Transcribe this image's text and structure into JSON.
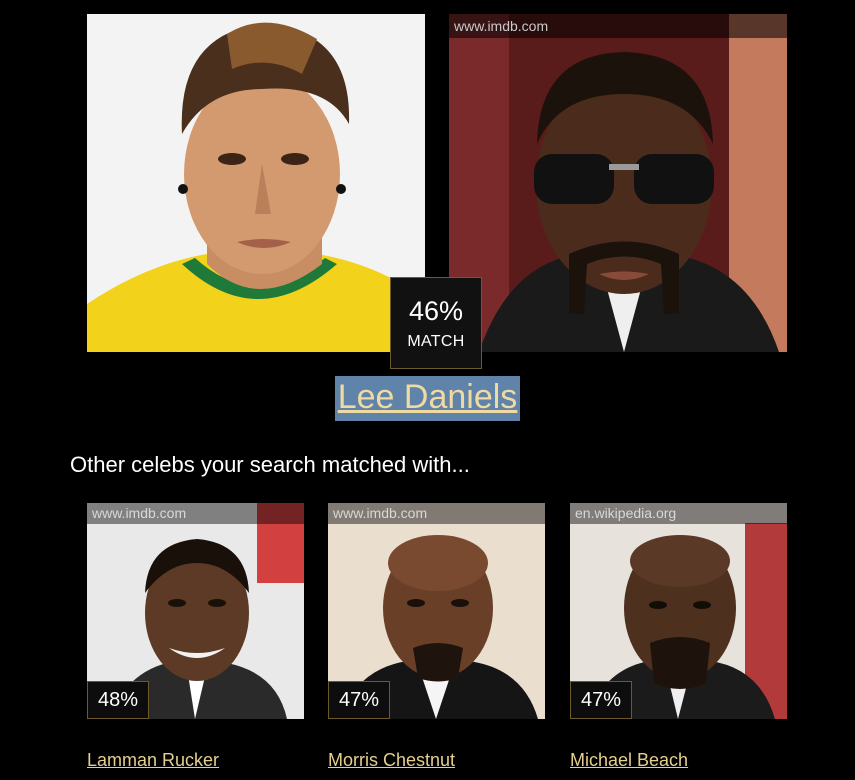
{
  "main_match": {
    "celeb_source": "www.imdb.com",
    "percent": "46%",
    "match_label": "MATCH",
    "celeb_name": "Lee Daniels"
  },
  "others_heading": "Other celebs your search matched with...",
  "others": [
    {
      "source": "www.imdb.com",
      "percent": "48%",
      "name": "Lamman Rucker"
    },
    {
      "source": "www.imdb.com",
      "percent": "47%",
      "name": "Morris Chestnut"
    },
    {
      "source": "en.wikipedia.org",
      "percent": "47%",
      "name": "Michael Beach"
    }
  ],
  "colors": {
    "background": "#000000",
    "name_highlight": "#5f83a9",
    "link_gold": "#e5cf8e",
    "match_border": "#6b5a2a"
  }
}
